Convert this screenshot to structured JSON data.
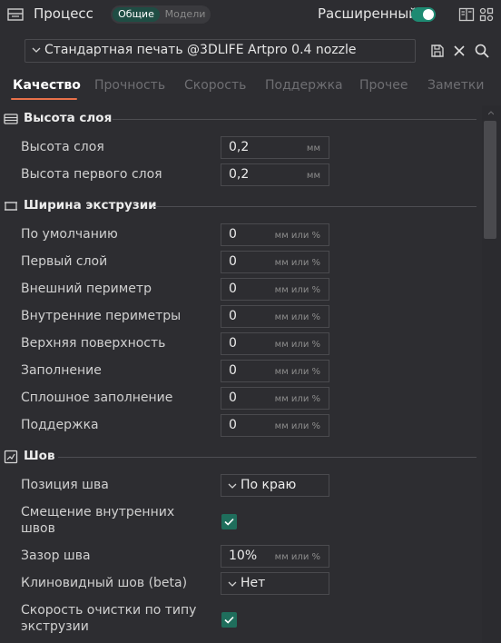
{
  "header": {
    "title": "Процесс",
    "mode_active": "Общие",
    "mode_inactive": "Модели",
    "advanced_label": "Расширенный",
    "advanced_enabled": true
  },
  "preset": {
    "name": "Стандартная печать @3DLIFE Artpro 0.4 nozzle"
  },
  "tabs": [
    "Качество",
    "Прочность",
    "Скорость",
    "Поддержка",
    "Прочее",
    "Заметки"
  ],
  "active_tab": "Качество",
  "sections": {
    "layer_height": {
      "title": "Высота слоя",
      "rows": [
        {
          "label": "Высота слоя",
          "value": "0,2",
          "unit": "мм"
        },
        {
          "label": "Высота первого слоя",
          "value": "0,2",
          "unit": "мм"
        }
      ]
    },
    "line_width": {
      "title": "Ширина экструзии",
      "rows": [
        {
          "label": "По умолчанию",
          "value": "0",
          "unit": "мм или %"
        },
        {
          "label": "Первый слой",
          "value": "0",
          "unit": "мм или %"
        },
        {
          "label": "Внешний периметр",
          "value": "0",
          "unit": "мм или %"
        },
        {
          "label": "Внутренние периметры",
          "value": "0",
          "unit": "мм или %"
        },
        {
          "label": "Верхняя поверхность",
          "value": "0",
          "unit": "мм или %"
        },
        {
          "label": "Заполнение",
          "value": "0",
          "unit": "мм или %"
        },
        {
          "label": "Сплошное заполнение",
          "value": "0",
          "unit": "мм или %"
        },
        {
          "label": "Поддержка",
          "value": "0",
          "unit": "мм или %"
        }
      ]
    },
    "seam": {
      "title": "Шов",
      "seam_position_label": "Позиция шва",
      "seam_position_value": "По краю",
      "staggered_label_1": "Смещение внутренних",
      "staggered_label_2": "швов",
      "staggered_checked": true,
      "seam_gap_label": "Зазор шва",
      "seam_gap_value": "10%",
      "seam_gap_unit": "мм или %",
      "scarf_label": "Клиновидный шов (beta)",
      "scarf_value": "Нет",
      "wipe_label_1": "Скорость очистки по типу",
      "wipe_label_2": "экструзии",
      "wipe_checked": true
    }
  },
  "colors": {
    "accent": "#1f6e5c",
    "toggle": "#1e8a72",
    "tab_underline": "#e8714a",
    "background": "#2d2d31"
  },
  "icons": {
    "process": "process-icon",
    "compare": "compare-icon",
    "settings": "grid-settings-icon",
    "save": "save-icon",
    "close": "close-icon",
    "search": "search-icon"
  }
}
